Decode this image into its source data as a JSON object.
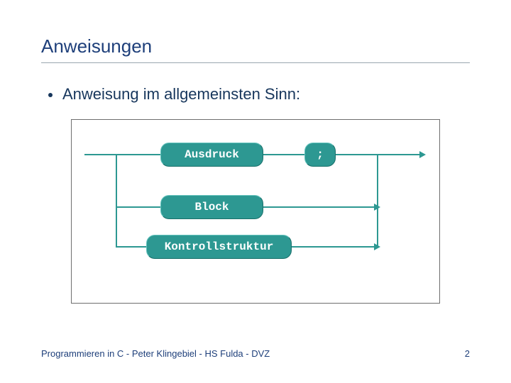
{
  "title": "Anweisungen",
  "bullet": "Anweisung im allgemeinsten Sinn:",
  "diagram": {
    "nodes": {
      "ausdruck": "Ausdruck",
      "semicolon": ";",
      "block": "Block",
      "kontroll": "Kontrollstruktur"
    }
  },
  "footer": {
    "left": "Programmieren in C - Peter Klingebiel - HS Fulda - DVZ",
    "page": "2"
  }
}
